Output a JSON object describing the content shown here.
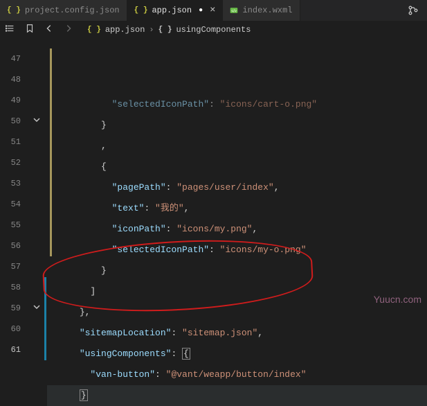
{
  "tabs": [
    {
      "label": "project.config.json",
      "active": false,
      "dirty": false,
      "iconKind": "json"
    },
    {
      "label": "app.json",
      "active": true,
      "dirty": true,
      "iconKind": "json"
    },
    {
      "label": "index.wxml",
      "active": false,
      "dirty": false,
      "iconKind": "wxml"
    }
  ],
  "breadcrumb": {
    "file": "app.json",
    "symbol": "usingComponents"
  },
  "lineStart": 47,
  "lines": [
    {
      "n": 47,
      "indent": 5,
      "tokens": [
        {
          "t": "key",
          "v": "selectedIconPath"
        },
        {
          "t": "punct",
          "v": ": "
        },
        {
          "t": "str",
          "v": "icons/cart-o.png"
        }
      ],
      "faded": true
    },
    {
      "n": 48,
      "indent": 4,
      "tokens": [
        {
          "t": "punct",
          "v": "}"
        }
      ]
    },
    {
      "n": 49,
      "indent": 4,
      "tokens": [
        {
          "t": "punct",
          "v": ","
        }
      ]
    },
    {
      "n": 50,
      "indent": 4,
      "tokens": [
        {
          "t": "punct",
          "v": "{"
        }
      ],
      "fold": true
    },
    {
      "n": 51,
      "indent": 5,
      "tokens": [
        {
          "t": "key",
          "v": "pagePath"
        },
        {
          "t": "punct",
          "v": ": "
        },
        {
          "t": "str",
          "v": "pages/user/index"
        },
        {
          "t": "punct",
          "v": ","
        }
      ]
    },
    {
      "n": 52,
      "indent": 5,
      "tokens": [
        {
          "t": "key",
          "v": "text"
        },
        {
          "t": "punct",
          "v": ": "
        },
        {
          "t": "str",
          "v": "我的"
        },
        {
          "t": "punct",
          "v": ","
        }
      ]
    },
    {
      "n": 53,
      "indent": 5,
      "tokens": [
        {
          "t": "key",
          "v": "iconPath"
        },
        {
          "t": "punct",
          "v": ": "
        },
        {
          "t": "str",
          "v": "icons/my.png"
        },
        {
          "t": "punct",
          "v": ","
        }
      ]
    },
    {
      "n": 54,
      "indent": 5,
      "tokens": [
        {
          "t": "key",
          "v": "selectedIconPath"
        },
        {
          "t": "punct",
          "v": ": "
        },
        {
          "t": "str",
          "v": "icons/my-o.png"
        }
      ]
    },
    {
      "n": 55,
      "indent": 4,
      "tokens": [
        {
          "t": "punct",
          "v": "}"
        }
      ]
    },
    {
      "n": 56,
      "indent": 3,
      "tokens": [
        {
          "t": "punct",
          "v": "]"
        }
      ]
    },
    {
      "n": 57,
      "indent": 2,
      "tokens": [
        {
          "t": "punct",
          "v": "},"
        }
      ]
    },
    {
      "n": 58,
      "indent": 2,
      "tokens": [
        {
          "t": "key",
          "v": "sitemapLocation"
        },
        {
          "t": "punct",
          "v": ": "
        },
        {
          "t": "str",
          "v": "sitemap.json"
        },
        {
          "t": "punct",
          "v": ","
        }
      ],
      "changed": true
    },
    {
      "n": 59,
      "indent": 2,
      "tokens": [
        {
          "t": "key",
          "v": "usingComponents"
        },
        {
          "t": "punct",
          "v": ": "
        },
        {
          "t": "punct",
          "v": "{",
          "match": true
        }
      ],
      "fold": true,
      "changed": true
    },
    {
      "n": 60,
      "indent": 3,
      "tokens": [
        {
          "t": "key",
          "v": "van-button"
        },
        {
          "t": "punct",
          "v": ": "
        },
        {
          "t": "str",
          "v": "@vant/weapp/button/index"
        }
      ],
      "changed": true
    },
    {
      "n": 61,
      "indent": 2,
      "tokens": [
        {
          "t": "punct",
          "v": "}",
          "match": true
        }
      ],
      "current": true,
      "changed": true
    }
  ],
  "watermark": "Yuucn.com"
}
